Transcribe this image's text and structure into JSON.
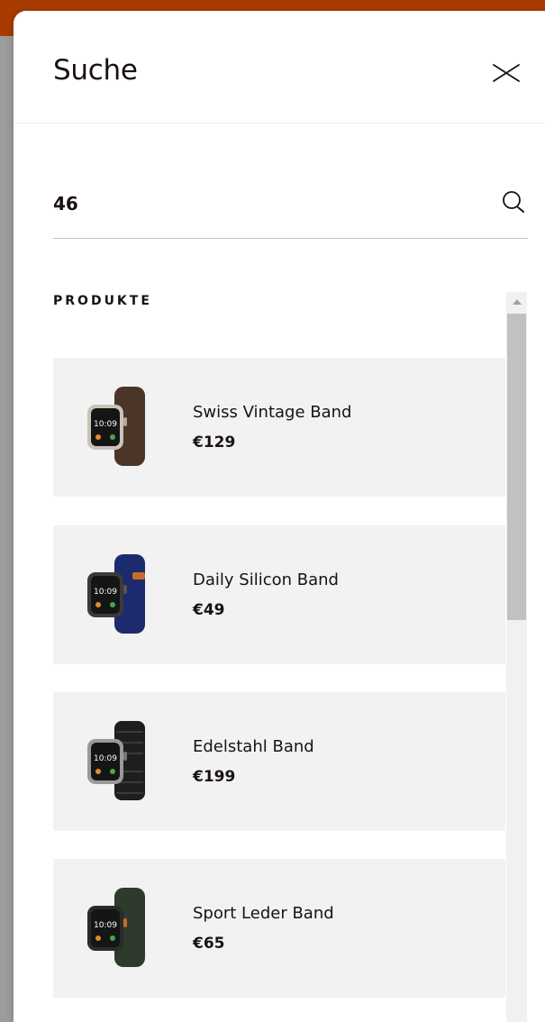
{
  "drawer": {
    "title": "Suche",
    "close_icon": "close-icon"
  },
  "search": {
    "value": "46",
    "icon": "search-icon"
  },
  "results": {
    "section_label": "PRODUKTE",
    "products": [
      {
        "name": "Swiss Vintage Band",
        "price": "€129",
        "strap_color": "#4a3528",
        "case_color": "#c9c3b8"
      },
      {
        "name": "Daily Silicon Band",
        "price": "€49",
        "strap_color": "#1c2a6e",
        "case_color": "#3a3a3a"
      },
      {
        "name": "Edelstahl Band",
        "price": "€199",
        "strap_color": "#1e1e1e",
        "case_color": "#9a9a9a"
      },
      {
        "name": "Sport Leder Band",
        "price": "€65",
        "strap_color": "#2e3a2c",
        "case_color": "#2a2a2a"
      }
    ]
  },
  "colors": {
    "accent_bar": "#a83c00",
    "card_bg": "#f2f2f2"
  }
}
